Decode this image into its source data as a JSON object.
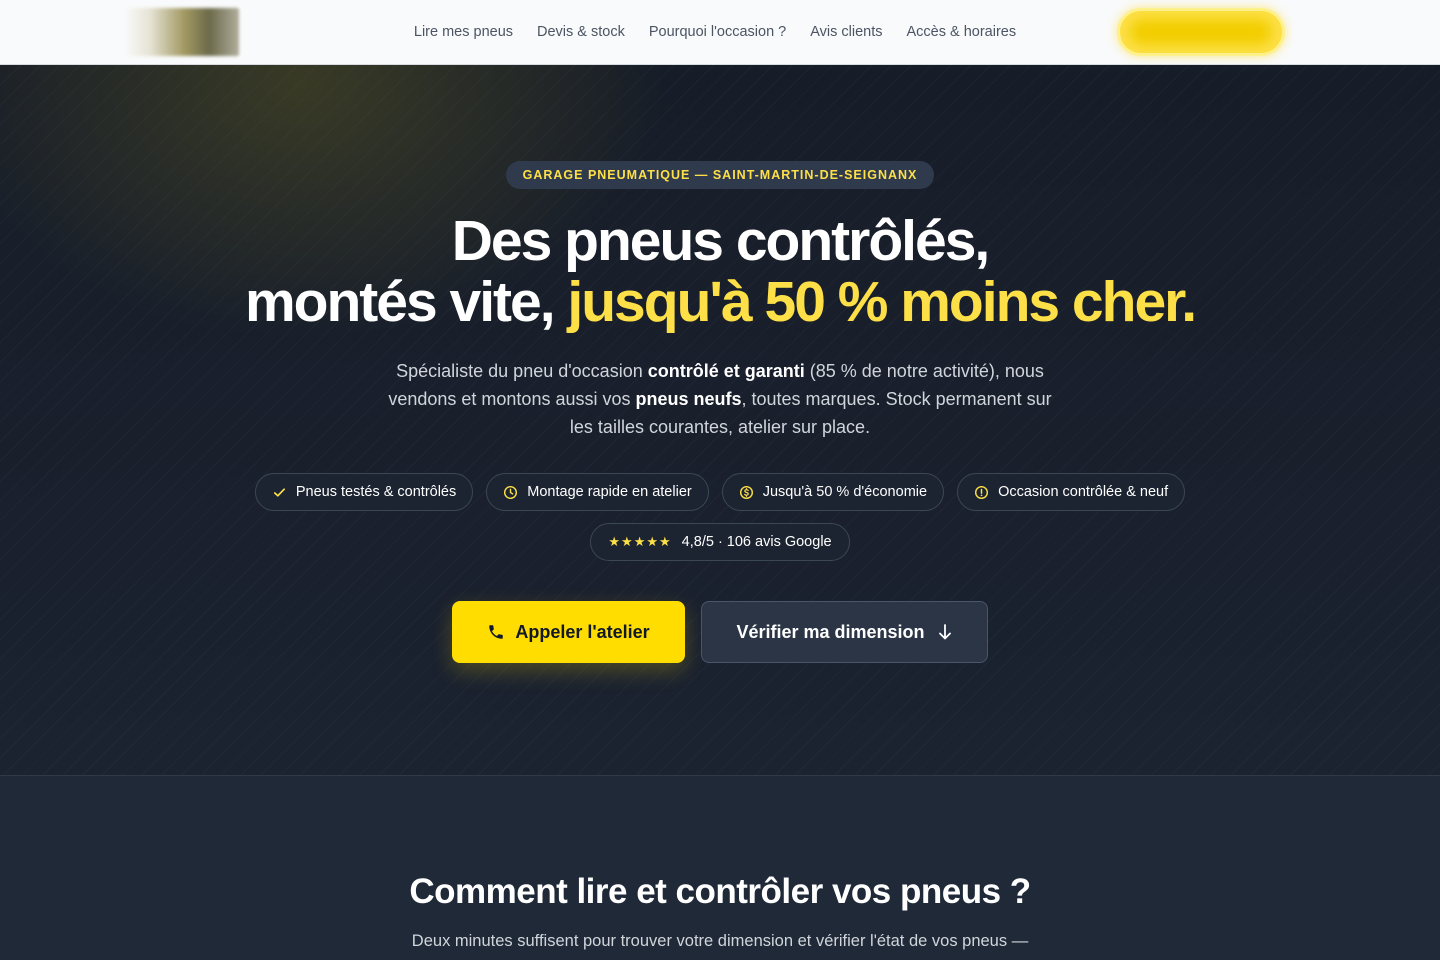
{
  "header": {
    "logo": "logo",
    "nav": [
      {
        "label": "Lire mes pneus"
      },
      {
        "label": "Devis & stock"
      },
      {
        "label": "Pourquoi l'occasion ?"
      },
      {
        "label": "Avis clients"
      },
      {
        "label": "Accès & horaires"
      }
    ],
    "cta_label": ""
  },
  "hero": {
    "eyebrow": "GARAGE PNEUMATIQUE — SAINT-MARTIN-DE-SEIGNANX",
    "headline": {
      "line1": "Des pneus contrôlés,",
      "line2_plain": "montés vite, ",
      "line2_highlight": "jusqu'à 50 % moins cher."
    },
    "lede": {
      "p1": "Spécialiste du pneu d'occasion ",
      "b1": "contrôlé et garanti",
      "p2": " (85 % de notre activité), nous vendons et montons aussi vos ",
      "b2": "pneus neufs",
      "p3": ", toutes marques. Stock permanent sur les tailles courantes, atelier sur place."
    },
    "pills": [
      {
        "label": "Pneus testés & contrôlés",
        "icon": "check-icon"
      },
      {
        "label": "Montage rapide en atelier",
        "icon": "clock-icon"
      },
      {
        "label": "Jusqu'à 50 % d'économie",
        "icon": "coin-icon"
      },
      {
        "label": "Occasion contrôlée & neuf",
        "icon": "info-icon"
      }
    ],
    "rating": {
      "stars": "★★★★★",
      "text": "4,8/5 · 106 avis Google"
    },
    "cta_call": "Appeler l'atelier",
    "cta_dimension": "Vérifier ma dimension"
  },
  "section2": {
    "title": "Comment lire et contrôler vos pneus ?",
    "intro": "Deux minutes suffisent pour trouver votre dimension et vérifier l'état de vos pneus —"
  },
  "colors": {
    "accent": "#fde047",
    "hero_bg": "#151c27",
    "section_bg": "#1f2937"
  }
}
